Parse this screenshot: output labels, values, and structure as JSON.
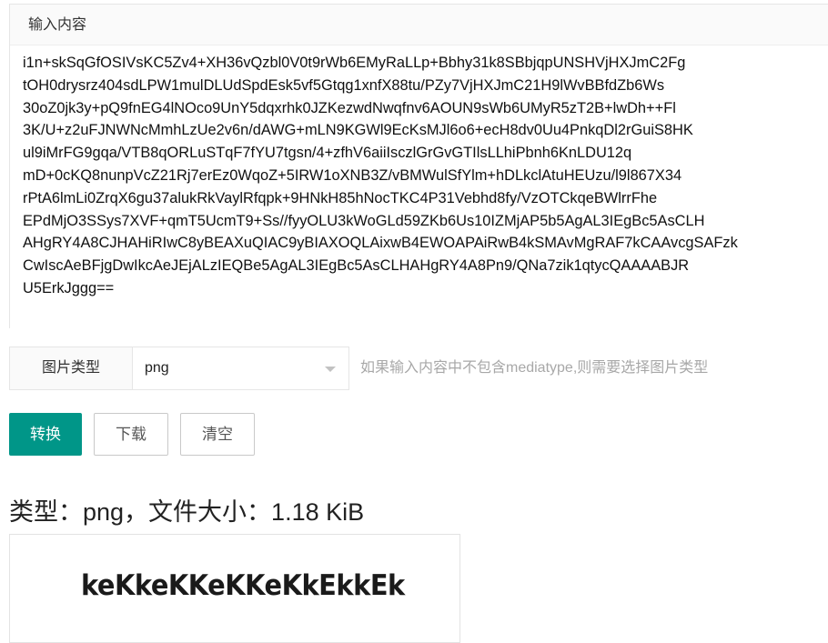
{
  "input_panel": {
    "title": "输入内容",
    "value": "i1n+skSqGfOSIVsKC5Zv4+XH36vQzbl0V0t9rWb6EMyRaLLp+Bbhy31k8SBbjqpUNSHVjHXJmC2Fg\ntOH0drysrz404sdLPW1mulDLUdSpdEsk5vf5Gtqg1xnfX88tu/PZy7VjHXJmC21H9lWvBBfdZb6Ws\n30oZ0jk3y+pQ9fnEG4lNOco9UnY5dqxrhk0JZKezwdNwqfnv6AOUN9sWb6UMyR5zT2B+lwDh++Fl\n3K/U+z2uFJNWNcMmhLzUe2v6n/dAWG+mLN9KGWl9EcKsMJl6o6+ecH8dv0Uu4PnkqDl2rGuiS8HK\nul9iMrFG9gqa/VTB8qORLuSTqF7fYU7tgsn/4+zfhV6aiiIsczlGrGvGTIlsLLhiPbnh6KnLDU12q\nmD+0cKQ8nunpVcZ21Rj7erEz0WqoZ+5IRW1oXNB3Z/vBMWulSfYlm+hDLkclAtuHEUzu/l9l867X34\nrPtA6lmLi0ZrqX6gu37alukRkVaylRfqpk+9HNkH85hNocTKC4P31Vebhd8fy/VzOTCkqeBWlrrFhe\nEPdMjO3SSys7XVF+qmT5UcmT9+Ss//fyyOLU3kWoGLd59ZKb6Us10IZMjAP5b5AgAL3IEgBc5AsCLH\nAHgRY4A8CJHAHiRIwC8yBEAXuQIAC9yBIAXOQLAixwB4EWOAPAiRwB4kSMAvMgRAF7kCAAvcgSAFzk\nCwIscAeBFjgDwIkcAeJEjALzIEQBe5AgAL3IEgBc5AsCLHAHgRY4A8Pn9/QNa7zik1qtycQAAAABJR\nU5ErkJggg=="
  },
  "image_type": {
    "label": "图片类型",
    "selected": "png",
    "hint": "如果输入内容中不包含mediatype,则需要选择图片类型"
  },
  "buttons": {
    "convert": "转换",
    "download": "下载",
    "clear": "清空"
  },
  "result": {
    "info": "类型：png，文件大小：1.18 KiB",
    "preview_text": "keKkeKKeKKeKkEkkEk"
  },
  "colors": {
    "primary": "#009688",
    "hint": "#a8a8a8",
    "border": "#e6e6e6",
    "header_bg": "#fafafa"
  },
  "icons": {
    "select_caret": "caret-down-icon"
  }
}
